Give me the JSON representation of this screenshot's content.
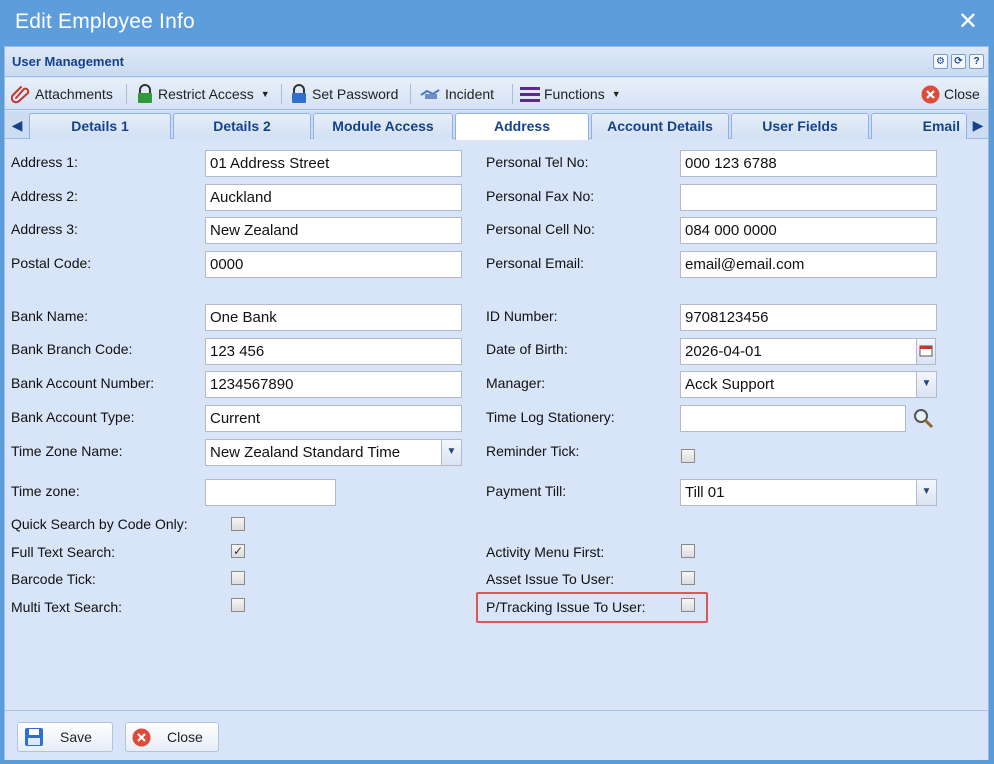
{
  "window": {
    "title": "Edit Employee Info",
    "close_glyph": "✕"
  },
  "panel": {
    "title": "User Management",
    "tools": [
      "gear-icon",
      "refresh-icon",
      "help-icon"
    ]
  },
  "toolbar": {
    "attachments": "Attachments",
    "restrict_access": "Restrict Access",
    "set_password": "Set Password",
    "incident": "Incident",
    "functions": "Functions",
    "close": "Close"
  },
  "tabs": [
    "Details 1",
    "Details 2",
    "Module Access",
    "Address",
    "Account Details",
    "User Fields",
    "Email"
  ],
  "active_tab": "Address",
  "left": {
    "address1": {
      "label": "Address 1:",
      "value": "01 Address Street"
    },
    "address2": {
      "label": "Address 2:",
      "value": "Auckland"
    },
    "address3": {
      "label": "Address 3:",
      "value": "New Zealand"
    },
    "postal_code": {
      "label": "Postal Code:",
      "value": "0000"
    },
    "bank_name": {
      "label": "Bank Name:",
      "value": "One Bank"
    },
    "bank_branch_code": {
      "label": "Bank Branch Code:",
      "value": "123 456"
    },
    "bank_account_number": {
      "label": "Bank Account Number:",
      "value": "1234567890"
    },
    "bank_account_type": {
      "label": "Bank Account Type:",
      "value": "Current"
    },
    "time_zone_name": {
      "label": "Time Zone Name:",
      "value": "New Zealand Standard Time"
    },
    "time_zone": {
      "label": "Time zone:",
      "value": ""
    },
    "quick_search": {
      "label": "Quick Search by Code Only:",
      "checked": false
    },
    "full_text_search": {
      "label": "Full Text Search:",
      "checked": true
    },
    "barcode_tick": {
      "label": "Barcode Tick:",
      "checked": false
    },
    "multi_text_search": {
      "label": "Multi Text Search:",
      "checked": false
    }
  },
  "right": {
    "personal_tel": {
      "label": "Personal Tel No:",
      "value": "000 123 6788"
    },
    "personal_fax": {
      "label": "Personal Fax No:",
      "value": ""
    },
    "personal_cell": {
      "label": "Personal Cell No:",
      "value": "084 000 0000"
    },
    "personal_email": {
      "label": "Personal Email:",
      "value": "email@email.com"
    },
    "id_number": {
      "label": "ID Number:",
      "value": "9708123456"
    },
    "date_of_birth": {
      "label": "Date of Birth:",
      "value": "2026-04-01"
    },
    "manager": {
      "label": "Manager:",
      "value": "Acck Support"
    },
    "time_log_stationery": {
      "label": "Time Log Stationery:",
      "value": ""
    },
    "reminder_tick": {
      "label": "Reminder Tick:",
      "checked": false
    },
    "payment_till": {
      "label": "Payment Till:",
      "value": "Till 01"
    },
    "activity_menu_first": {
      "label": "Activity Menu First:",
      "checked": false
    },
    "asset_issue": {
      "label": "Asset Issue To User:",
      "checked": false
    },
    "ptracking_issue": {
      "label": "P/Tracking Issue To User:",
      "checked": false
    }
  },
  "footer": {
    "save": "Save",
    "close": "Close"
  },
  "colors": {
    "title_bar": "#5d9ddb",
    "panel_bg": "#d8e4f8",
    "tab_text": "#15428b",
    "highlight": "#e05555"
  }
}
